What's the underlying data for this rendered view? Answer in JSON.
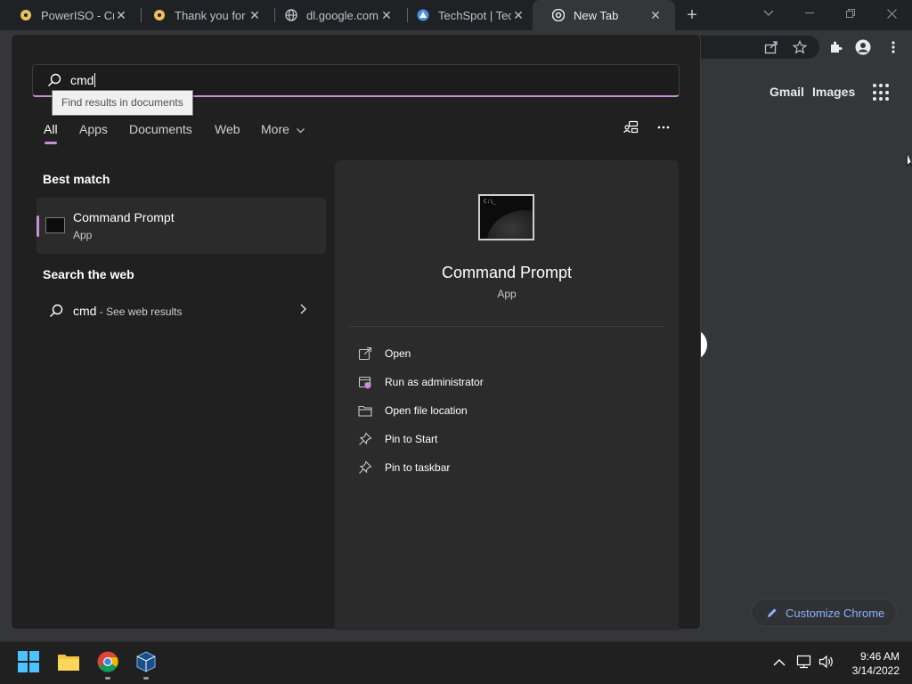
{
  "browser": {
    "tabs": [
      {
        "title": "PowerISO - Crea",
        "icon": "poweriso-icon",
        "active": false
      },
      {
        "title": "Thank you for i",
        "icon": "poweriso-icon",
        "active": false
      },
      {
        "title": "dl.google.com",
        "icon": "globe-icon",
        "active": false
      },
      {
        "title": "TechSpot | Tech",
        "icon": "techspot-icon",
        "active": false
      },
      {
        "title": "New Tab",
        "icon": "chrome-icon",
        "active": true
      }
    ],
    "new_tab_label": "+",
    "ntp_links": {
      "gmail": "Gmail",
      "images": "Images"
    },
    "customize_label": "Customize Chrome"
  },
  "search": {
    "query": "cmd",
    "tooltip": "Find results in documents",
    "filters": [
      "All",
      "Apps",
      "Documents",
      "Web",
      "More"
    ],
    "best_match_title": "Best match",
    "best_match": {
      "name": "Command Prompt",
      "type": "App"
    },
    "web_title": "Search the web",
    "web_result": {
      "query": "cmd",
      "suffix": " - See web results"
    },
    "detail": {
      "name": "Command Prompt",
      "type": "App",
      "actions": [
        "Open",
        "Run as administrator",
        "Open file location",
        "Pin to Start",
        "Pin to taskbar"
      ]
    }
  },
  "taskbar": {
    "apps": [
      "start-icon",
      "file-explorer-icon",
      "chrome-icon",
      "virtualbox-icon"
    ],
    "time": "9:46 AM",
    "date": "3/14/2022"
  },
  "colors": {
    "accent": "#c88fd6",
    "panel": "#202020",
    "detail": "#2b2b2b",
    "link": "#8ab4f8"
  }
}
